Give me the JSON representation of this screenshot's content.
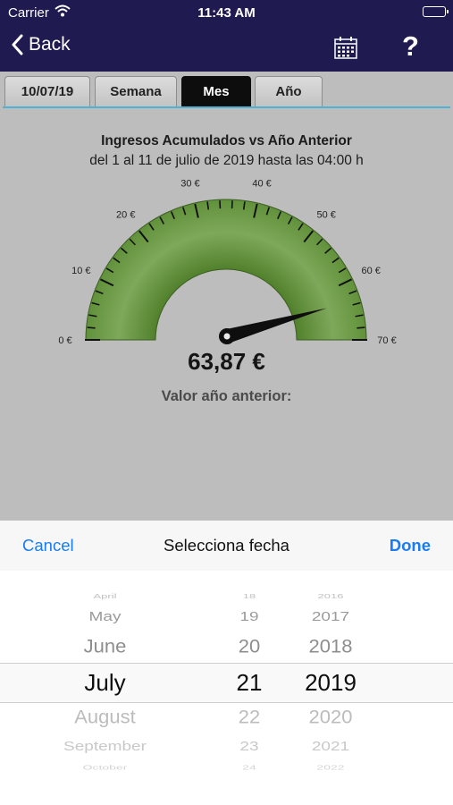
{
  "status": {
    "carrier": "Carrier",
    "time": "11:43 AM"
  },
  "nav": {
    "back_label": "Back",
    "calendar_icon": "calendar-icon",
    "help_label": "?"
  },
  "tabs": [
    {
      "label": "10/07/19",
      "active": false
    },
    {
      "label": "Semana",
      "active": false
    },
    {
      "label": "Mes",
      "active": true
    },
    {
      "label": "Año",
      "active": false
    }
  ],
  "report": {
    "title": "Ingresos Acumulados vs Año Anterior",
    "subtitle": "del 1 al 11 de julio de 2019 hasta las 04:00 h",
    "value": "63,87 €",
    "previous_label": "Valor año anterior:"
  },
  "gauge": {
    "min": 0,
    "max": 70,
    "value": 63.87,
    "labels": [
      "0 €",
      "10 €",
      "20 €",
      "30 €",
      "40 €",
      "50 €",
      "60 €",
      "70 €"
    ],
    "color": "#5a8a36"
  },
  "sheet": {
    "cancel_label": "Cancel",
    "title": "Selecciona fecha",
    "done_label": "Done"
  },
  "picker": {
    "months": [
      "April",
      "May",
      "June",
      "July",
      "August",
      "September",
      "October"
    ],
    "days": [
      "18",
      "19",
      "20",
      "21",
      "22",
      "23",
      "24"
    ],
    "years": [
      "2016",
      "2017",
      "2018",
      "2019",
      "2020",
      "2021",
      "2022"
    ],
    "selected": {
      "month": "July",
      "day": "21",
      "year": "2019"
    }
  }
}
